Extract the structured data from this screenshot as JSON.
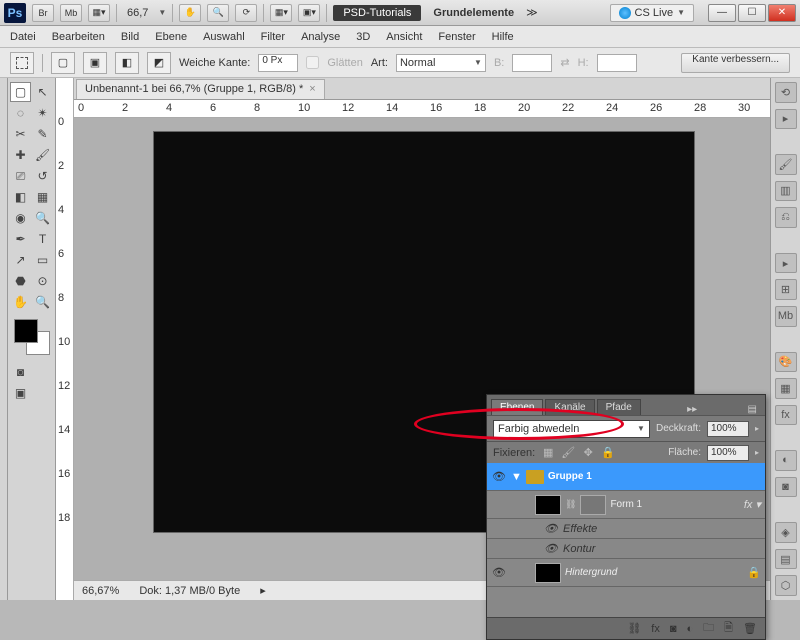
{
  "titlebar": {
    "zoom": "66,7",
    "app": "PSD-Tutorials",
    "doc": "Grundelemente",
    "cslive": "CS Live"
  },
  "menu": [
    "Datei",
    "Bearbeiten",
    "Bild",
    "Ebene",
    "Auswahl",
    "Filter",
    "Analyse",
    "3D",
    "Ansicht",
    "Fenster",
    "Hilfe"
  ],
  "options": {
    "feather_label": "Weiche Kante:",
    "feather_value": "0 Px",
    "antialias": "Glätten",
    "style_label": "Art:",
    "style_value": "Normal",
    "w": "B:",
    "h": "H:",
    "refine": "Kante verbessern..."
  },
  "doc_tab": "Unbenannt-1 bei 66,7% (Gruppe 1, RGB/8) *",
  "ruler_h": [
    0,
    2,
    4,
    6,
    8,
    10,
    12,
    14,
    16,
    18,
    20,
    22,
    24,
    26,
    28,
    30
  ],
  "ruler_v": [
    0,
    2,
    4,
    6,
    8,
    10,
    12,
    14,
    16,
    18
  ],
  "status": {
    "zoom": "66,67%",
    "info": "Dok: 1,37 MB/0 Byte"
  },
  "layers": {
    "tabs": [
      "Ebenen",
      "Kanäle",
      "Pfade"
    ],
    "blend": "Farbig abwedeln",
    "opacity_label": "Deckkraft:",
    "opacity": "100%",
    "lock_label": "Fixieren:",
    "fill_label": "Fläche:",
    "fill": "100%",
    "group": "Gruppe 1",
    "shape": "Form 1",
    "fx_label": "Effekte",
    "fx_stroke": "Kontur",
    "bg": "Hintergrund"
  }
}
